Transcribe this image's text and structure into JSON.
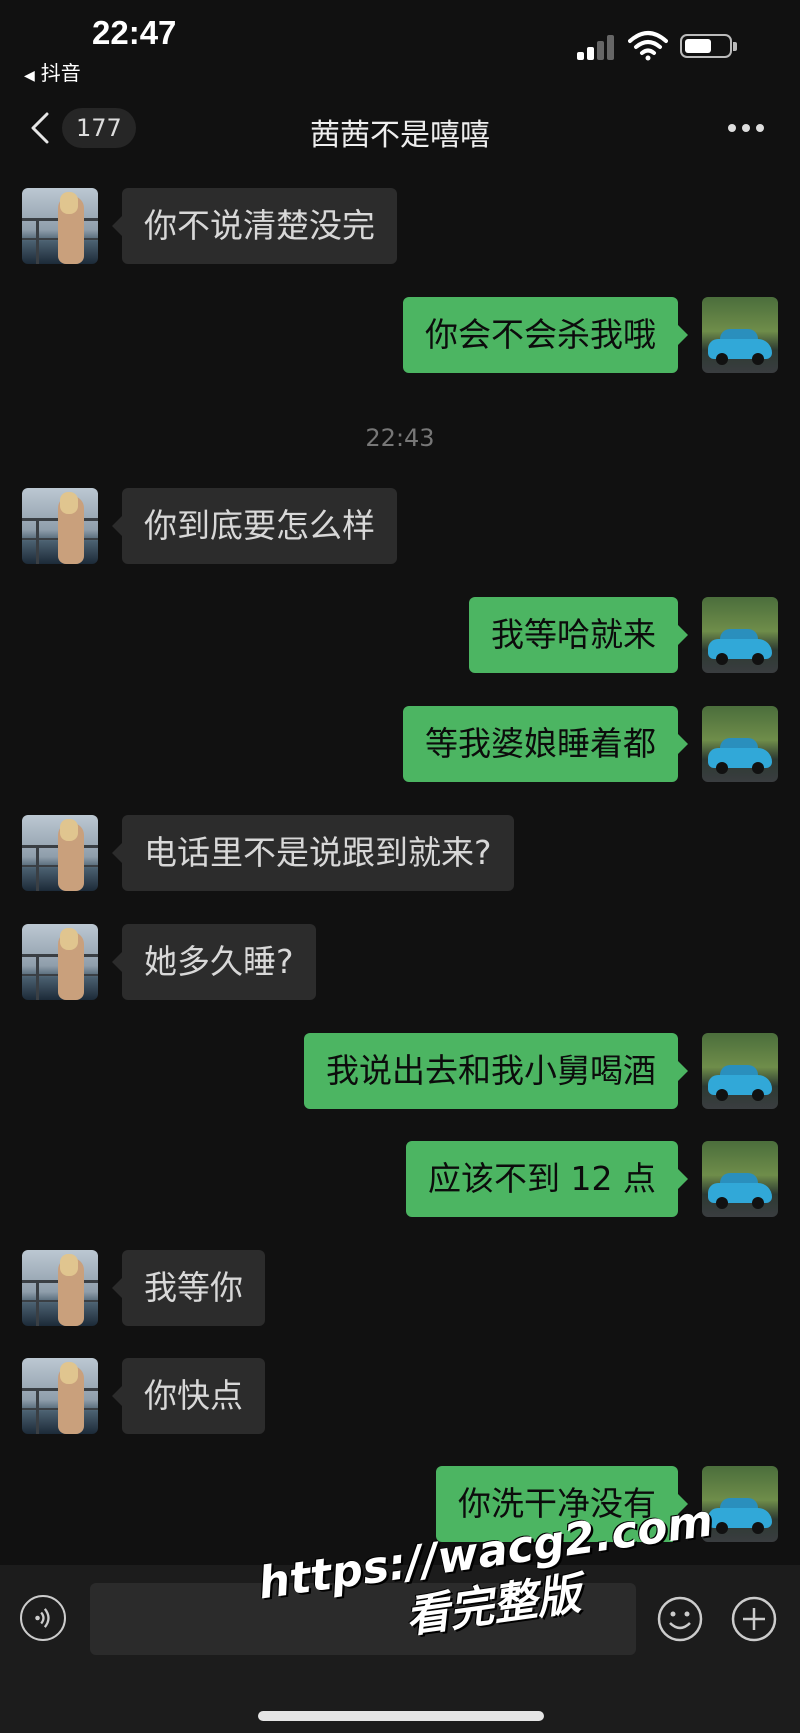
{
  "status_bar": {
    "time": "22:47",
    "back_app": "抖音",
    "back_glyph": "◀"
  },
  "header": {
    "unread_count": "177",
    "title": "茜茜不是嘻嘻"
  },
  "conversation": {
    "timestamp": "22:43",
    "messages": [
      {
        "side": "in",
        "text": "你不说清楚没完"
      },
      {
        "side": "out",
        "text": "你会不会杀我哦"
      },
      {
        "side": "in",
        "text": "你到底要怎么样"
      },
      {
        "side": "out",
        "text": "我等哈就来"
      },
      {
        "side": "out",
        "text": "等我婆娘睡着都"
      },
      {
        "side": "in",
        "text": "电话里不是说跟到就来?"
      },
      {
        "side": "in",
        "text": "她多久睡?"
      },
      {
        "side": "out",
        "text": "我说出去和我小舅喝酒"
      },
      {
        "side": "out",
        "text": "应该不到 12 点"
      },
      {
        "side": "in",
        "text": "我等你"
      },
      {
        "side": "in",
        "text": "你快点"
      },
      {
        "side": "out",
        "text": "你洗干净没有"
      }
    ]
  },
  "input_bar": {
    "placeholder": ""
  },
  "watermark": {
    "line1": "https://wacg2.com",
    "line2": "看完整版"
  },
  "colors": {
    "background": "#111111",
    "incoming_bubble": "#2c2c2c",
    "outgoing_bubble": "#4cb562"
  },
  "icons": {
    "back": "chevron-left-icon",
    "more": "more-dots-icon",
    "voice": "voice-icon",
    "emoji": "emoji-icon",
    "plus": "plus-icon"
  }
}
